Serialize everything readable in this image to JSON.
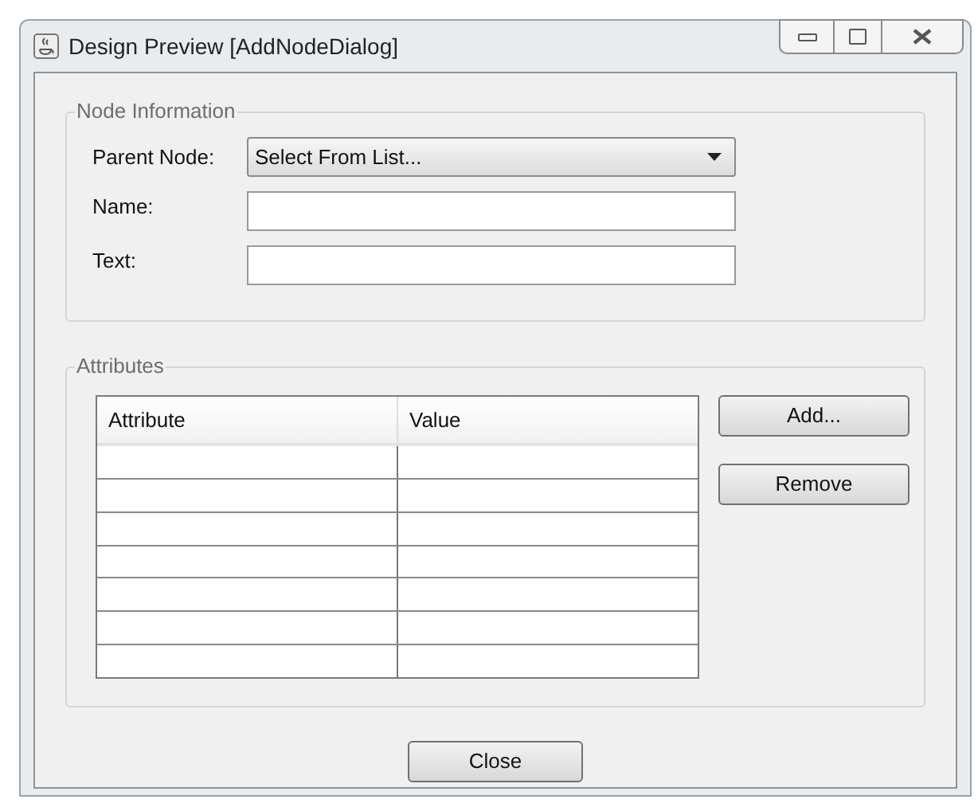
{
  "window": {
    "title": "Design Preview [AddNodeDialog]"
  },
  "node_information": {
    "legend": "Node Information",
    "parent_node": {
      "label": "Parent Node:",
      "value": "Select From List..."
    },
    "name": {
      "label": "Name:"
    },
    "text": {
      "label": "Text:"
    }
  },
  "attributes": {
    "legend": "Attributes",
    "table": {
      "columns": [
        "Attribute",
        "Value"
      ],
      "rows": [
        {
          "selected": false
        },
        {
          "selected": false
        },
        {
          "selected": false
        },
        {
          "selected": false
        },
        {
          "selected": false
        },
        {
          "selected": false
        },
        {
          "selected": false
        }
      ]
    },
    "buttons": [
      "Add...",
      "Remove"
    ]
  },
  "footer_buttons": [
    "Close"
  ]
}
